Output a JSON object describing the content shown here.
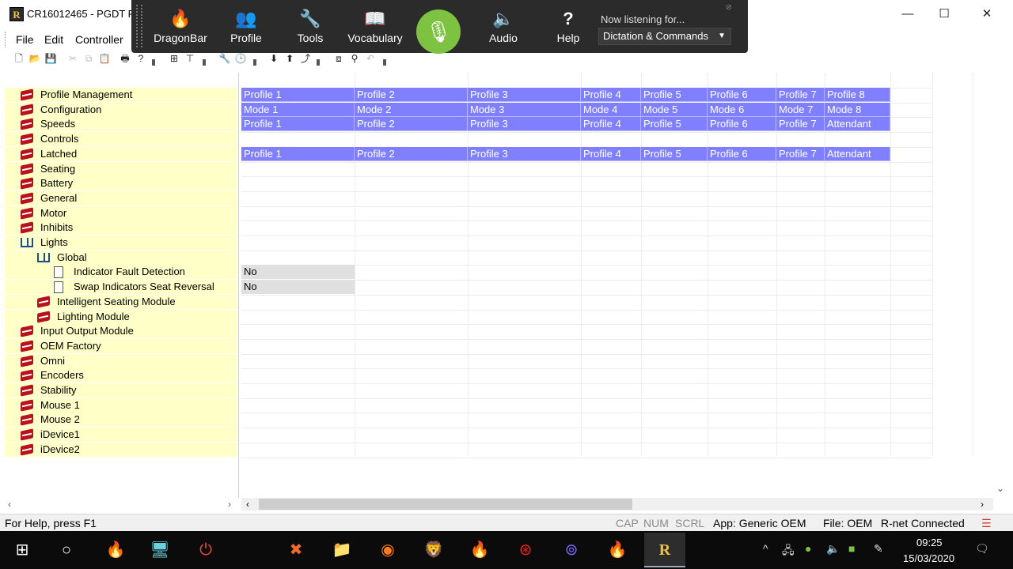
{
  "window": {
    "logo_letter": "R",
    "title": "CR16012465 - PGDT F",
    "minimize_glyph": "—",
    "maximize_glyph": "☐",
    "close_glyph": "✕"
  },
  "menu": {
    "items": [
      "File",
      "Edit",
      "Controller"
    ]
  },
  "dragonbar": {
    "buttons": [
      {
        "label": "DragonBar",
        "icon": "dragon-flame-icon",
        "glyph": "🔥"
      },
      {
        "label": "Profile",
        "icon": "profile-people-icon",
        "glyph": "👥"
      },
      {
        "label": "Tools",
        "icon": "wrench-icon",
        "glyph": "🔧"
      },
      {
        "label": "Vocabulary",
        "icon": "vocabulary-book-icon",
        "glyph": "📖"
      },
      {
        "label": "Audio",
        "icon": "speaker-icon",
        "glyph": "🔈"
      },
      {
        "label": "Help",
        "icon": "help-icon",
        "glyph": "?"
      }
    ],
    "mic_glyph": "🎙",
    "mic_color": "#7ec242",
    "listening_label": "Now listening for...",
    "listening_mode": "Dictation & Commands"
  },
  "tree": {
    "items": [
      {
        "label": "Profile Management",
        "level": 0,
        "icon": "closed-book"
      },
      {
        "label": "Configuration",
        "level": 0,
        "icon": "closed-book"
      },
      {
        "label": "Speeds",
        "level": 0,
        "icon": "closed-book"
      },
      {
        "label": "Controls",
        "level": 0,
        "icon": "closed-book"
      },
      {
        "label": "Latched",
        "level": 0,
        "icon": "closed-book"
      },
      {
        "label": "Seating",
        "level": 0,
        "icon": "closed-book"
      },
      {
        "label": "Battery",
        "level": 0,
        "icon": "closed-book"
      },
      {
        "label": "General",
        "level": 0,
        "icon": "closed-book"
      },
      {
        "label": "Motor",
        "level": 0,
        "icon": "closed-book"
      },
      {
        "label": "Inhibits",
        "level": 0,
        "icon": "closed-book"
      },
      {
        "label": "Lights",
        "level": 0,
        "icon": "open-book"
      },
      {
        "label": "Global",
        "level": 1,
        "icon": "open-book"
      },
      {
        "label": "Indicator Fault Detection",
        "level": 2,
        "icon": "page"
      },
      {
        "label": "Swap Indicators Seat Reversal",
        "level": 2,
        "icon": "page"
      },
      {
        "label": "Intelligent Seating Module",
        "level": 1,
        "icon": "closed-book"
      },
      {
        "label": "Lighting Module",
        "level": 1,
        "icon": "closed-book"
      },
      {
        "label": "Input Output Module",
        "level": 0,
        "icon": "closed-book"
      },
      {
        "label": "OEM Factory",
        "level": 0,
        "icon": "closed-book"
      },
      {
        "label": "Omni",
        "level": 0,
        "icon": "closed-book"
      },
      {
        "label": "Encoders",
        "level": 0,
        "icon": "closed-book"
      },
      {
        "label": "Stability",
        "level": 0,
        "icon": "closed-book"
      },
      {
        "label": "Mouse 1",
        "level": 0,
        "icon": "closed-book"
      },
      {
        "label": "Mouse 2",
        "level": 0,
        "icon": "closed-book"
      },
      {
        "label": "iDevice1",
        "level": 0,
        "icon": "closed-book"
      },
      {
        "label": "iDevice2",
        "level": 0,
        "icon": "closed-book"
      }
    ]
  },
  "grid": {
    "rows": [
      {
        "row": 0,
        "style": "selected",
        "cells": [
          "Profile 1",
          "Profile 2",
          "Profile 3",
          "Profile 4",
          "Profile 5",
          "Profile 6",
          "Profile 7",
          "Profile 8"
        ]
      },
      {
        "row": 1,
        "style": "selected",
        "cells": [
          "Mode 1",
          "Mode 2",
          "Mode 3",
          "Mode 4",
          "Mode 5",
          "Mode 6",
          "Mode 7",
          "Mode 8"
        ]
      },
      {
        "row": 2,
        "style": "selected",
        "cells": [
          "Profile 1",
          "Profile 2",
          "Profile 3",
          "Profile 4",
          "Profile 5",
          "Profile 6",
          "Profile 7",
          "Attendant"
        ]
      },
      {
        "row": 4,
        "style": "selected",
        "cells": [
          "Profile 1",
          "Profile 2",
          "Profile 3",
          "Profile 4",
          "Profile 5",
          "Profile 6",
          "Profile 7",
          "Attendant"
        ]
      },
      {
        "row": 12,
        "style": "grey",
        "cells": [
          "No"
        ]
      },
      {
        "row": 13,
        "style": "grey",
        "cells": [
          "No"
        ]
      }
    ],
    "selected_color": "#8080ff"
  },
  "status": {
    "help": "For Help, press F1",
    "cap": "CAP",
    "num": "NUM",
    "scrl": "SCRL",
    "app": "App: Generic OEM",
    "file": "File: OEM",
    "connection": "R-net Connected"
  },
  "taskbar": {
    "time": "09:25",
    "date": "15/03/2020"
  }
}
